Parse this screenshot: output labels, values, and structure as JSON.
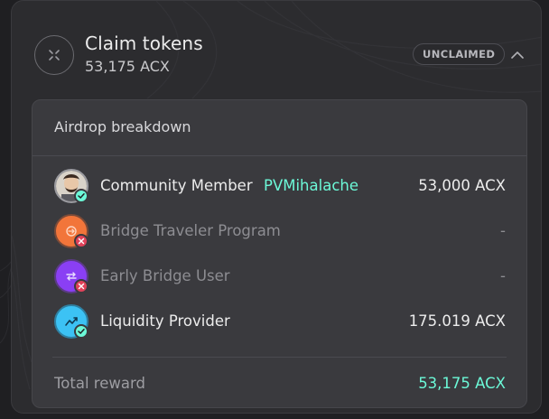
{
  "claim": {
    "title": "Claim tokens",
    "amount": "53,175 ACX",
    "status": "UNCLAIMED",
    "icon": "acx-logo-icon",
    "chevron_icon": "chevron-up-icon"
  },
  "breakdown": {
    "title": "Airdrop breakdown",
    "rows": [
      {
        "label": "Community Member",
        "user": "PVMihalache",
        "value": "53,000 ACX",
        "eligible": true,
        "icon": "avatar-icon",
        "icon_color": "#3c3c40"
      },
      {
        "label": "Bridge Traveler Program",
        "user": "",
        "value": "-",
        "eligible": false,
        "icon": "bridge-traveler-icon",
        "icon_color": "#f2753a"
      },
      {
        "label": "Early Bridge User",
        "user": "",
        "value": "-",
        "eligible": false,
        "icon": "early-bridge-icon",
        "icon_color": "#8a3ff4"
      },
      {
        "label": "Liquidity Provider",
        "user": "",
        "value": "175.019 ACX",
        "eligible": true,
        "icon": "liquidity-provider-icon",
        "icon_color": "#3cc2f4"
      }
    ],
    "total_label": "Total reward",
    "total_value": "53,175 ACX"
  },
  "colors": {
    "accent": "#6cf9d8",
    "check_bg": "#6cf9d8",
    "cross_bg": "#e0425a",
    "panel": "#3a3a3e",
    "card": "#2c2c2f"
  }
}
